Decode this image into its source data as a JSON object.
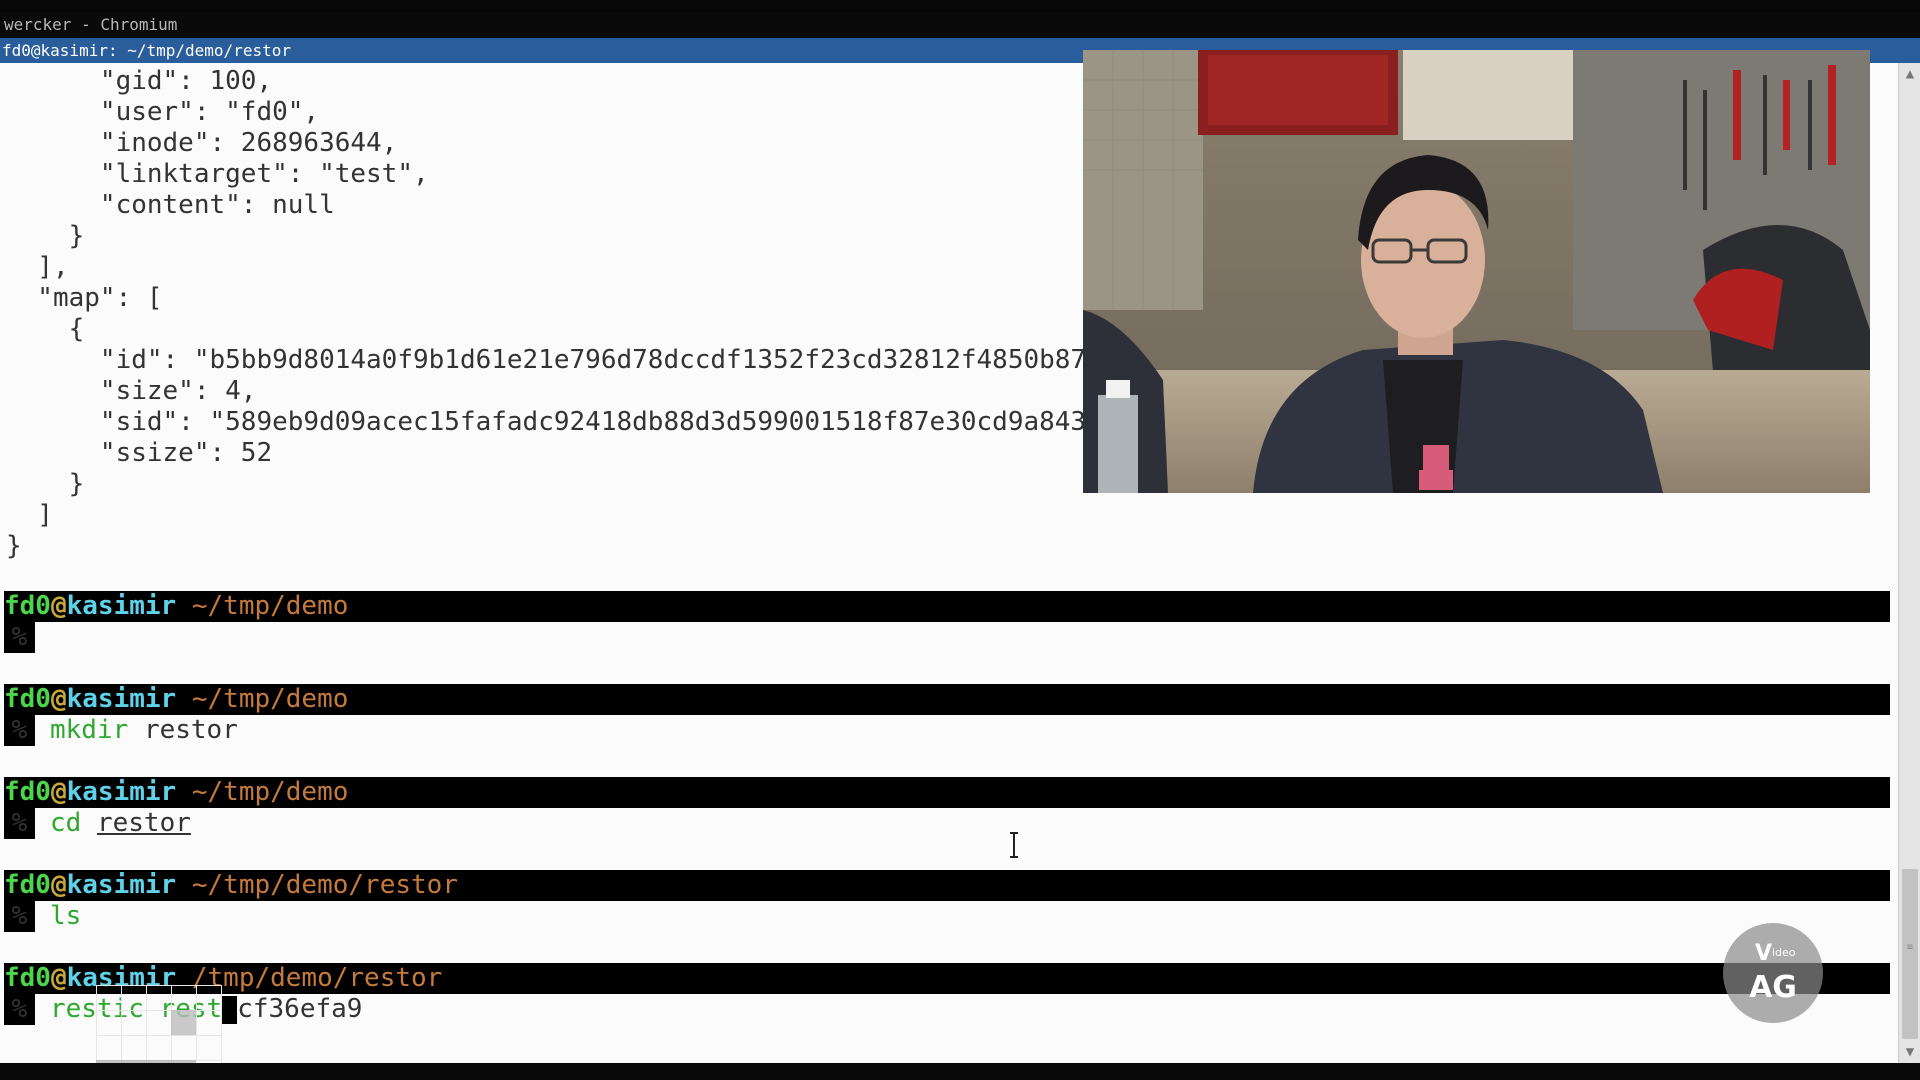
{
  "window": {
    "title": "wercker - Chromium"
  },
  "terminal": {
    "title": "fd0@kasimir: ~/tmp/demo/restor",
    "json_lines": [
      "      \"gid\": 100,",
      "      \"user\": \"fd0\",",
      "      \"inode\": 268963644,",
      "      \"linktarget\": \"test\",",
      "      \"content\": null",
      "    }",
      "  ],",
      "  \"map\": [",
      "    {",
      "      \"id\": \"b5bb9d8014a0f9b1d61e21e796d78dccdf1352f23cd32812f4850b878",
      "      \"size\": 4,",
      "      \"sid\": \"589eb9d09acec15fafadc92418db88d3d599001518f87e30cd9a843f",
      "      \"ssize\": 52",
      "    }",
      "  ]",
      "}"
    ],
    "prompt_user": "fd0",
    "prompt_at": "@",
    "prompt_host": "kasimir",
    "prompt_symbol": "%",
    "prompts": [
      {
        "path": "~/tmp/demo",
        "cmd": "",
        "arg": ""
      },
      {
        "path": "~/tmp/demo",
        "cmd": "mkdir",
        "arg": "restor"
      },
      {
        "path": "~/tmp/demo",
        "cmd": "cd",
        "arg": "restor"
      },
      {
        "path": "~/tmp/demo/restor",
        "cmd": "ls",
        "arg": ""
      },
      {
        "path": "/tmp/demo/restor",
        "cmd": "restic",
        "arg": "rest",
        "rest": "cf36efa9"
      }
    ]
  },
  "logo": {
    "top": "Video",
    "bottom": "AG"
  },
  "colors": {
    "title_bar": "#2a5d9c",
    "prompt_user": "#4bd64b",
    "prompt_host": "#5fd2ea",
    "prompt_path": "#c47a3c",
    "command": "#2fa82f"
  }
}
